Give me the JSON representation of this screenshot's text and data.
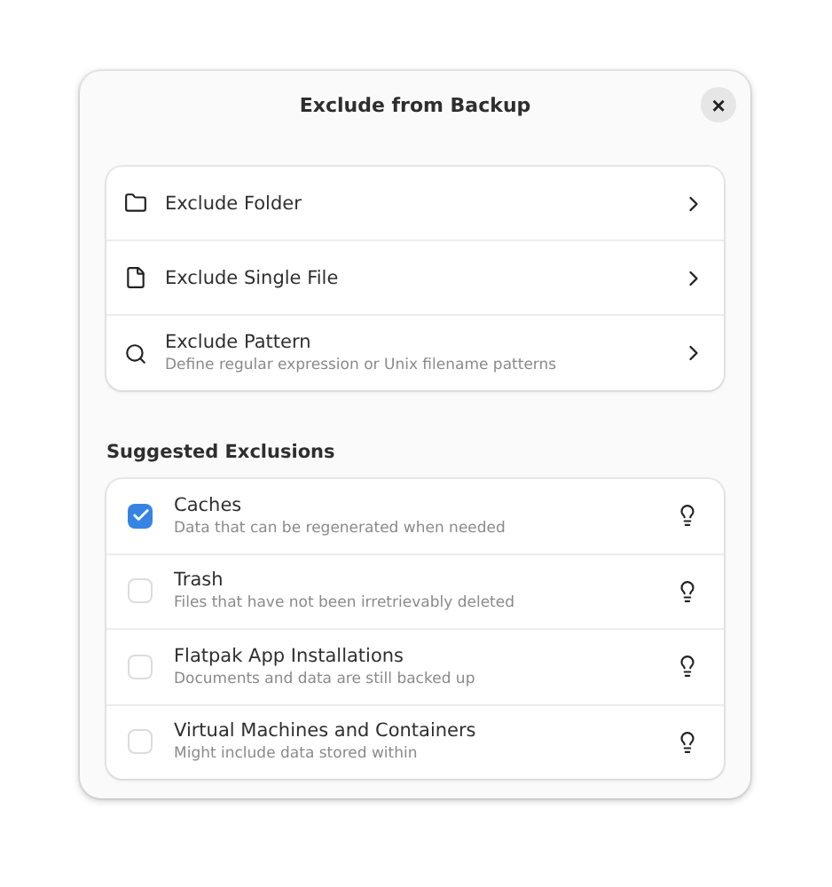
{
  "dialog": {
    "title": "Exclude from Backup",
    "close_label": "×"
  },
  "actions": [
    {
      "kind": "folder",
      "label": "Exclude Folder"
    },
    {
      "kind": "file",
      "label": "Exclude Single File"
    },
    {
      "kind": "search",
      "label": "Exclude Pattern",
      "subtitle": "Define regular expression or Unix filename patterns"
    }
  ],
  "suggested": {
    "heading": "Suggested Exclusions",
    "items": [
      {
        "label": "Caches",
        "subtitle": "Data that can be regenerated when needed",
        "checked": true
      },
      {
        "label": "Trash",
        "subtitle": "Files that have not been irretrievably deleted",
        "checked": false
      },
      {
        "label": "Flatpak App Installations",
        "subtitle": "Documents and data are still backed up",
        "checked": false
      },
      {
        "label": "Virtual Machines and Containers",
        "subtitle": "Might include data stored within",
        "checked": false
      }
    ]
  }
}
